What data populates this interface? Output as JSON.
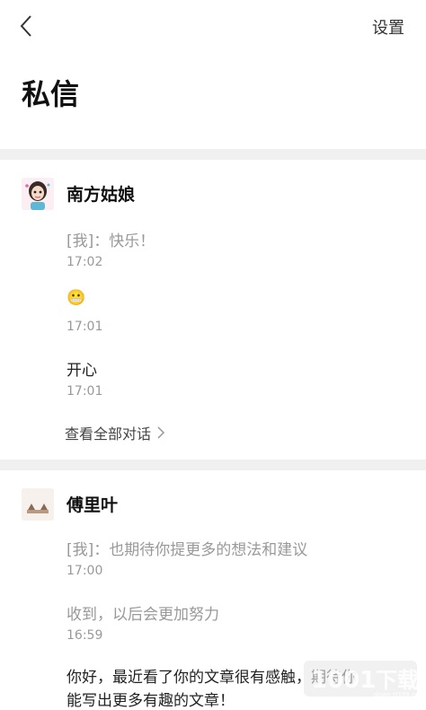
{
  "header": {
    "settings_label": "设置",
    "title": "私信"
  },
  "conversations": [
    {
      "name": "南方姑娘",
      "messages": [
        {
          "text": "[我]：快乐！",
          "time": "17:02",
          "self": true
        },
        {
          "text": "😬",
          "time": "17:01",
          "self": false
        },
        {
          "text": "开心",
          "time": "17:01",
          "self": false
        }
      ],
      "view_all": "查看全部对话"
    },
    {
      "name": "傅里叶",
      "messages": [
        {
          "text": "[我]：也期待你提更多的想法和建议",
          "time": "17:00",
          "self": true
        },
        {
          "text": "收到，以后会更加努力",
          "time": "16:59",
          "self": false
        },
        {
          "text_line1": "你好，最近看了你的文章很有感触，期待你",
          "text_line2": "能写出更多有趣的文章！",
          "self": false
        }
      ]
    }
  ],
  "icons": {
    "back": "chevron-left-icon",
    "view_all_arrow": "chevron-right-icon"
  },
  "colors": {
    "divider": "#f0f0f0",
    "muted_text": "#999999"
  }
}
